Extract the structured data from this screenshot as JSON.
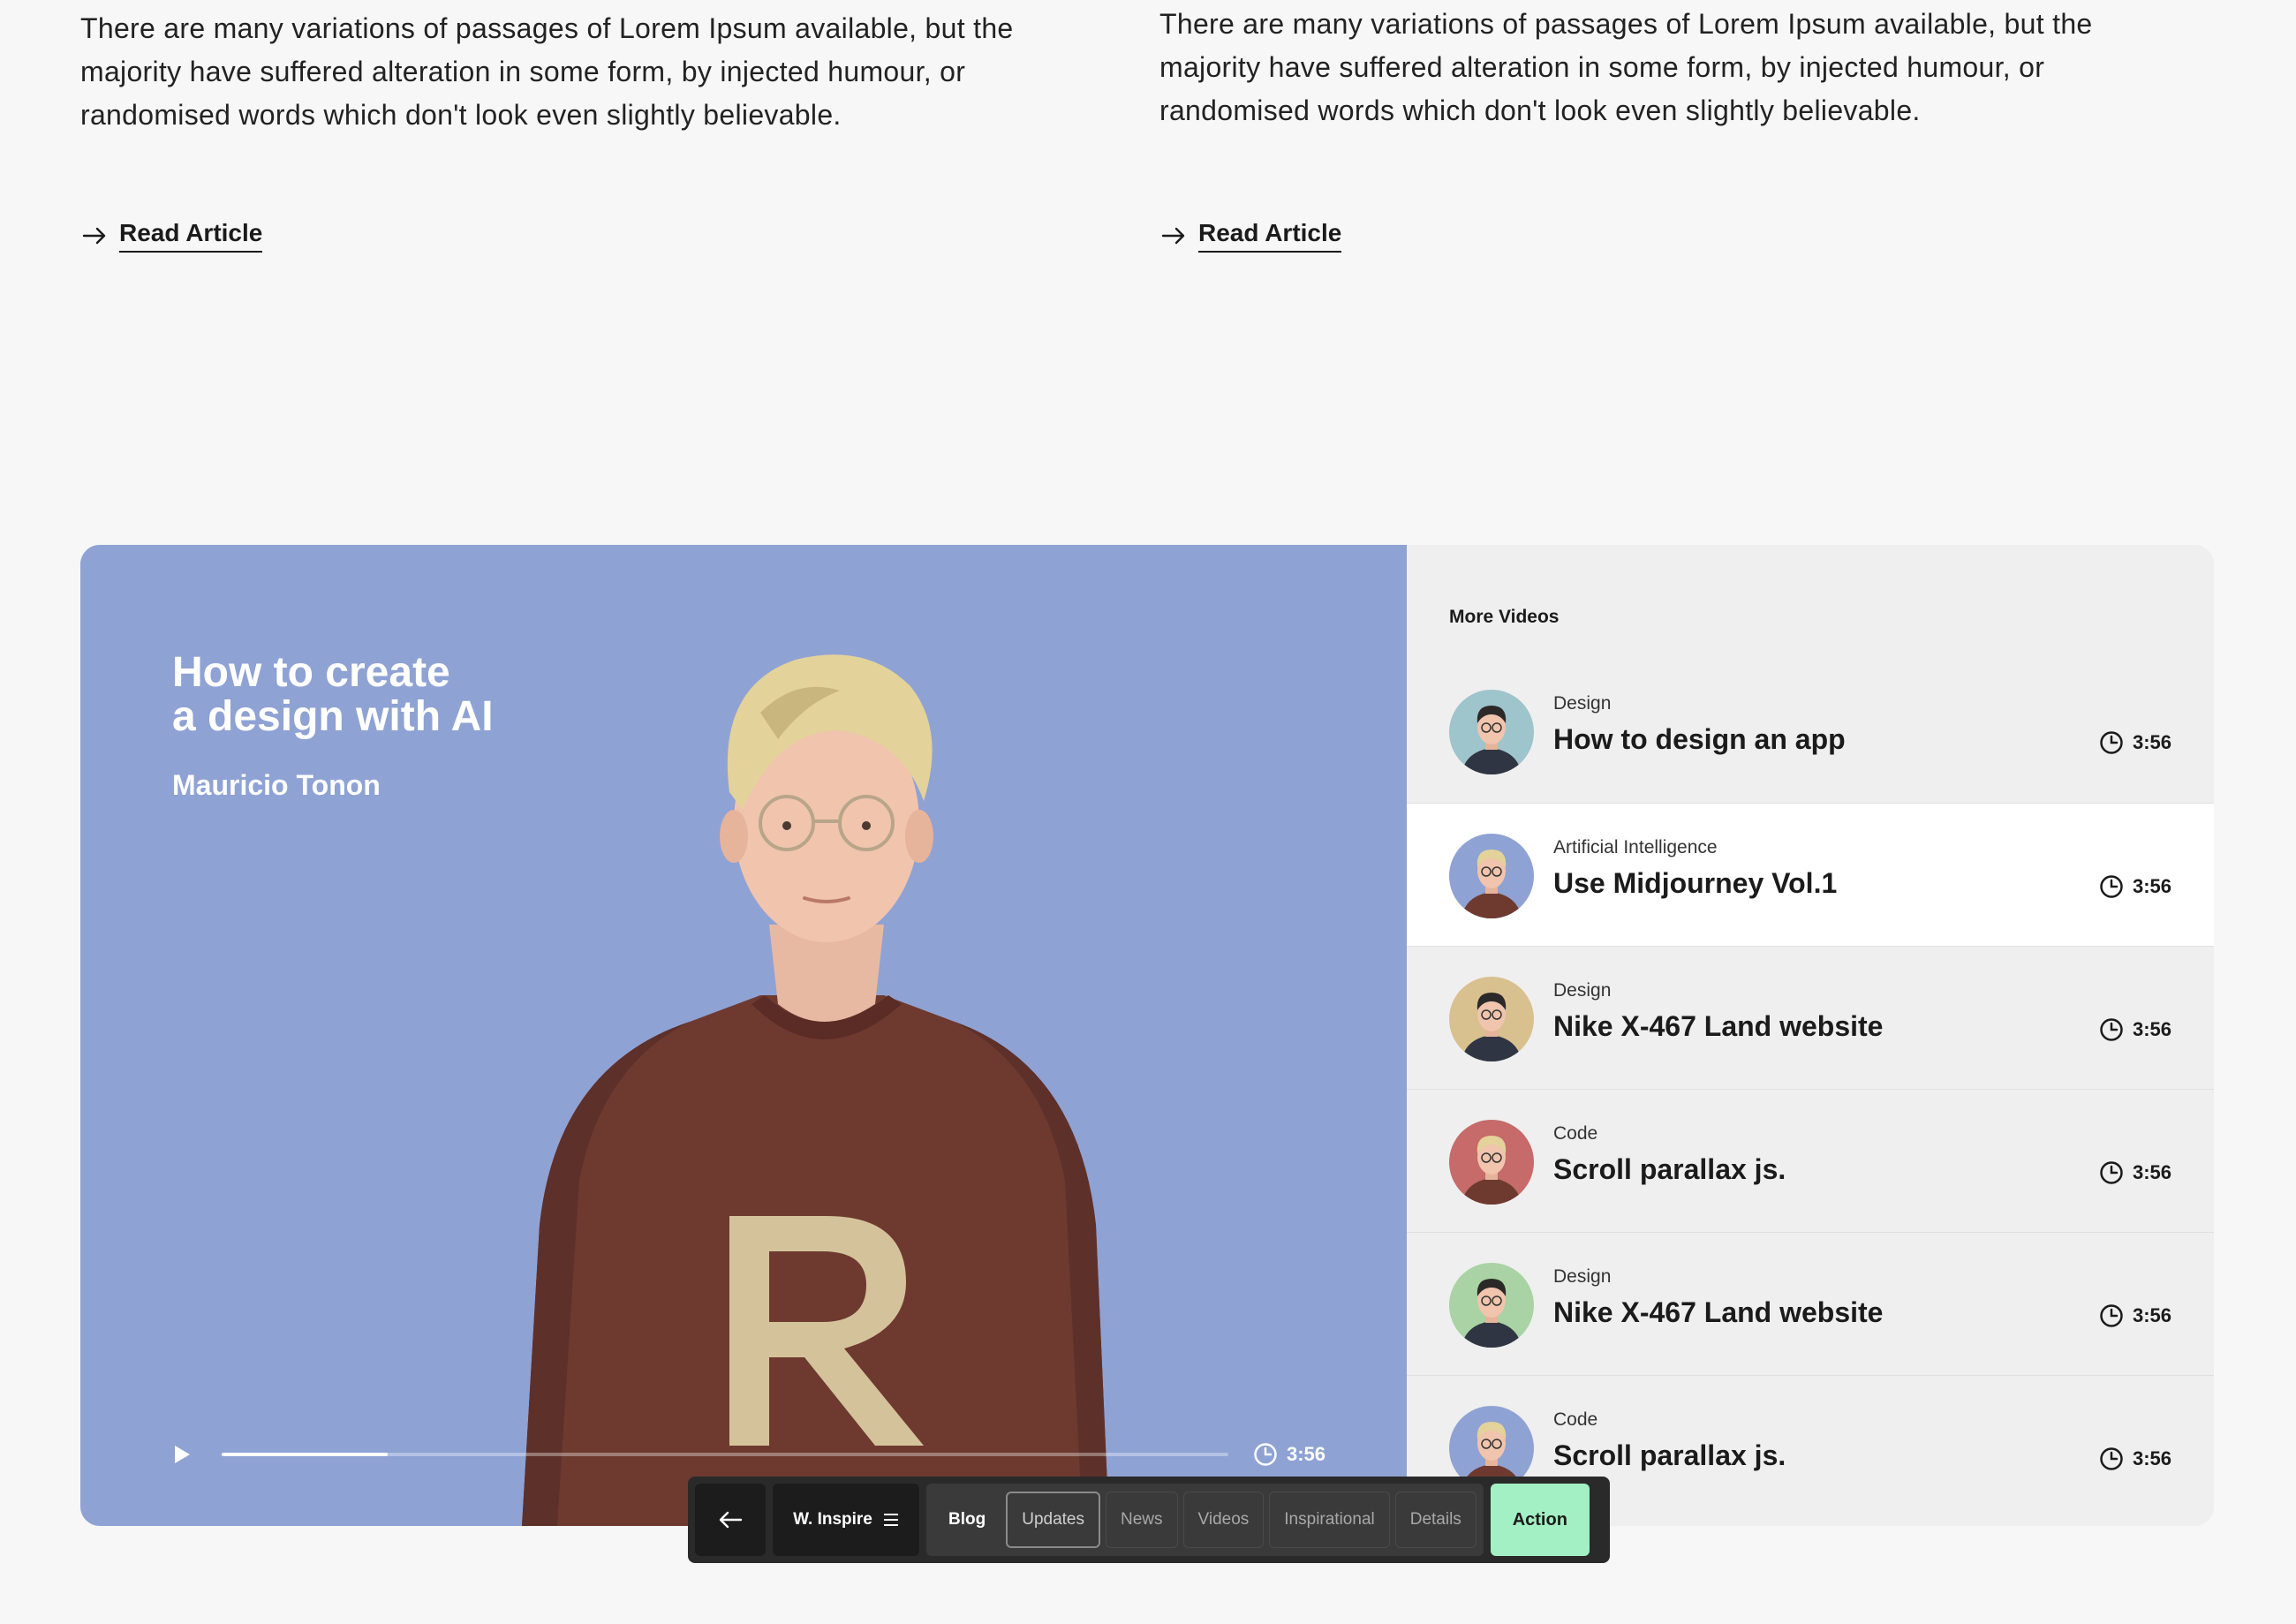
{
  "articles": [
    {
      "excerpt": "There are many variations of passages of Lorem Ipsum available, but the majority have suffered alteration in some form, by injected humour, or randomised words which don't look even slightly believable.",
      "link_label": "Read Article"
    },
    {
      "excerpt": "There are many variations of passages of Lorem Ipsum available, but the majority have suffered alteration in some form, by injected humour, or randomised words which don't look even slightly believable.",
      "link_label": "Read Article"
    }
  ],
  "featured_video": {
    "title_line1": "How to create",
    "title_line2": "a design with AI",
    "author": "Mauricio Tonon",
    "duration": "3:56",
    "progress": 0.165,
    "background_color": "#8fa2d4"
  },
  "more_videos": {
    "heading": "More Videos",
    "items": [
      {
        "category": "Design",
        "title": "How to design an app",
        "duration": "3:56",
        "avatar_bg": "#9ec4cc",
        "avatar_icon": "man-portrait",
        "active": false
      },
      {
        "category": "Artificial Intelligence",
        "title": "Use Midjourney Vol.1",
        "duration": "3:56",
        "avatar_bg": "#8fa2d4",
        "avatar_icon": "blond-man-portrait",
        "active": true
      },
      {
        "category": "Design",
        "title": "Nike X-467 Land website",
        "duration": "3:56",
        "avatar_bg": "#d9c08f",
        "avatar_icon": "man-portrait",
        "active": false
      },
      {
        "category": "Code",
        "title": "Scroll parallax js.",
        "duration": "3:56",
        "avatar_bg": "#c66a6a",
        "avatar_icon": "blond-man-portrait",
        "active": false
      },
      {
        "category": "Design",
        "title": "Nike X-467 Land website",
        "duration": "3:56",
        "avatar_bg": "#a9d3a4",
        "avatar_icon": "man-portrait",
        "active": false
      },
      {
        "category": "Code",
        "title": "Scroll parallax js.",
        "duration": "3:56",
        "avatar_bg": "#8fa2d4",
        "avatar_icon": "blond-man-portrait",
        "active": false
      }
    ]
  },
  "navbar": {
    "back_icon": "arrow-left-icon",
    "brand": "W. Inspire",
    "menu_icon": "hamburger-icon",
    "items": [
      {
        "label": "Blog",
        "state": "current"
      },
      {
        "label": "Updates",
        "state": "selected"
      },
      {
        "label": "News",
        "state": "default"
      },
      {
        "label": "Videos",
        "state": "default"
      },
      {
        "label": "Inspirational",
        "state": "default"
      },
      {
        "label": "Details",
        "state": "default"
      }
    ],
    "action_label": "Action",
    "action_color": "#a3f0c4"
  }
}
